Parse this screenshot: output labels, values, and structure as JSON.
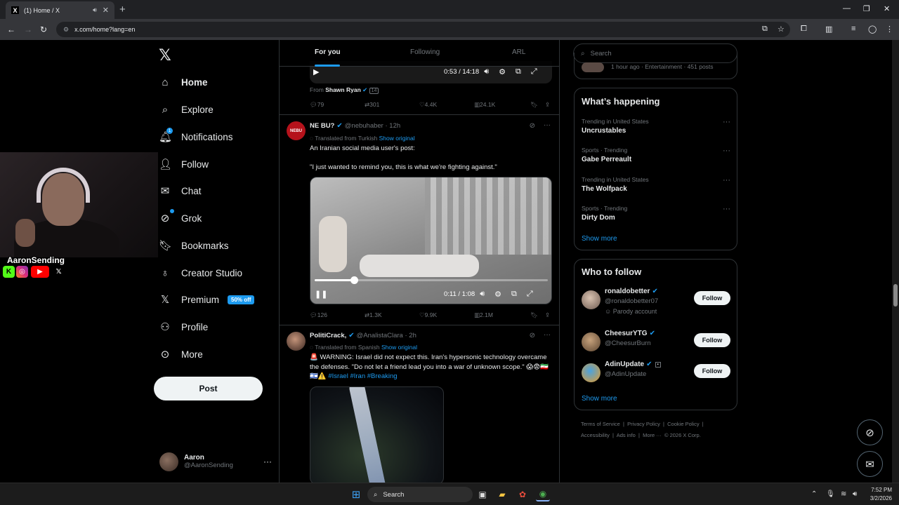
{
  "browser": {
    "tab_title": "(1) Home / X",
    "url": "x.com/home?lang=en"
  },
  "nav": {
    "items": [
      {
        "label": "Home",
        "icon": "home-icon"
      },
      {
        "label": "Explore",
        "icon": "search-icon"
      },
      {
        "label": "Notifications",
        "icon": "bell-icon",
        "badge": "1"
      },
      {
        "label": "Follow",
        "icon": "person-add-icon"
      },
      {
        "label": "Chat",
        "icon": "envelope-icon"
      },
      {
        "label": "Grok",
        "icon": "grok-icon"
      },
      {
        "label": "Bookmarks",
        "icon": "bookmark-icon"
      },
      {
        "label": "Creator Studio",
        "icon": "creator-studio-icon"
      },
      {
        "label": "Premium",
        "icon": "x-logo-icon",
        "badge": "50% off"
      },
      {
        "label": "Profile",
        "icon": "person-icon"
      },
      {
        "label": "More",
        "icon": "more-circle-icon"
      }
    ],
    "post_label": "Post",
    "account": {
      "name": "Aaron",
      "handle": "@AaronSending"
    }
  },
  "webcam": {
    "name": "AaronSending"
  },
  "timeline": {
    "tabs": [
      "For you",
      "Following",
      "ARL"
    ],
    "tweet0": {
      "time": "0:53 / 14:18",
      "from_label": "From",
      "from_name": "Shawn Ryan",
      "from_badge": "14",
      "replies": "79",
      "reposts": "301",
      "likes": "4.4K",
      "views": "24.1K"
    },
    "tweet1": {
      "name": "NE BU?",
      "handle": "@nebuhaber",
      "time": "12h",
      "translated": "Translated from Turkish",
      "show_original": "Show original",
      "line1": "An Iranian social media user's post:",
      "line2": "\"I just wanted to remind you, this is what we're fighting against.\"",
      "video_time": "0:11 / 1:08",
      "video_progress": 0.17,
      "replies": "126",
      "reposts": "1.3K",
      "likes": "9.9K",
      "views": "2.1M"
    },
    "tweet2": {
      "name": "PolitiCrack,",
      "handle": "@AnalistaClara",
      "time": "2h",
      "translated": "Translated from Spanish",
      "show_original": "Show original",
      "text": "🚨 WARNING: Israel did not expect this. Iran's hypersonic technology overcame the defenses. \"Do not let a friend lead you into a war of unknown scope.\" 😱😨🇮🇷🇮🇱⚠️",
      "tags": [
        "#Israel",
        "#Iran",
        "#Breaking"
      ]
    }
  },
  "sidebar": {
    "search_placeholder": "Search",
    "top_meta": "1 hour ago · Entertainment · 451 posts",
    "happening_title": "What’s happening",
    "trends": [
      {
        "category": "Trending in United States",
        "name": "Uncrustables"
      },
      {
        "category": "Sports · Trending",
        "name": "Gabe Perreault"
      },
      {
        "category": "Trending in United States",
        "name": "The Wolfpack"
      },
      {
        "category": "Sports · Trending",
        "name": "Dirty Dom"
      }
    ],
    "show_more": "Show more",
    "wtf_title": "Who to follow",
    "follow_label": "Follow",
    "wtf": [
      {
        "name": "ronaldobetter",
        "handle": "@ronaldobetter07",
        "note": "Parody account"
      },
      {
        "name": "CheesurYTG",
        "handle": "@CheesurBurn",
        "note": ""
      },
      {
        "name": "AdinUpdate",
        "handle": "@AdinUpdate",
        "note": ""
      }
    ],
    "footer": [
      "Terms of Service",
      "Privacy Policy",
      "Cookie Policy",
      "Accessibility",
      "Ads info",
      "More ···",
      "© 2026 X Corp."
    ]
  },
  "taskbar": {
    "search": "Search",
    "time": "7:52 PM",
    "date": "3/2/2026"
  }
}
